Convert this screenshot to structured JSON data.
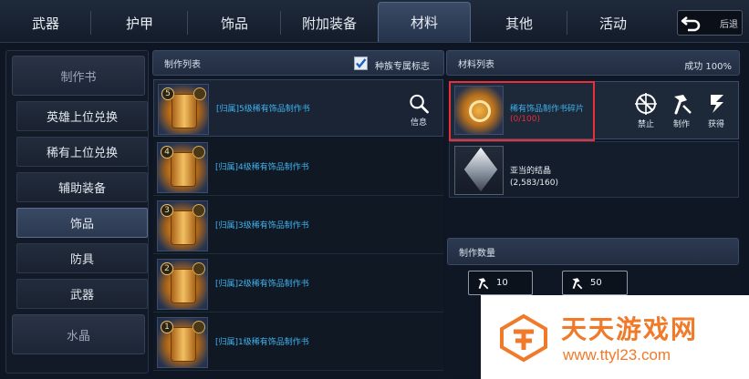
{
  "top_tabs": [
    {
      "label": "武器",
      "active": false
    },
    {
      "label": "护甲",
      "active": false
    },
    {
      "label": "饰品",
      "active": false
    },
    {
      "label": "附加装备",
      "active": false
    },
    {
      "label": "材料",
      "active": true
    },
    {
      "label": "其他",
      "active": false
    },
    {
      "label": "活动",
      "active": false
    }
  ],
  "back_button": {
    "label": "后退",
    "icon": "undo-arrow-icon"
  },
  "sidebar": {
    "header_top": "制作书",
    "items": [
      {
        "label": "英雄上位兑换",
        "active": false
      },
      {
        "label": "稀有上位兑换",
        "active": false
      },
      {
        "label": "辅助装备",
        "active": false
      },
      {
        "label": "饰品",
        "active": true
      },
      {
        "label": "防具",
        "active": false
      },
      {
        "label": "武器",
        "active": false
      }
    ],
    "header_bottom": "水晶"
  },
  "craft_list": {
    "title": "制作列表",
    "race_filter_label": "种族专属标志",
    "race_filter_checked": true,
    "info_label": "信息",
    "recipes": [
      {
        "level": "5",
        "name": "[归属]5级稀有饰品制作书",
        "selected": true
      },
      {
        "level": "4",
        "name": "[归属]4级稀有饰品制作书",
        "selected": false
      },
      {
        "level": "3",
        "name": "[归属]3级稀有饰品制作书",
        "selected": false
      },
      {
        "level": "2",
        "name": "[归属]2级稀有饰品制作书",
        "selected": false
      },
      {
        "level": "1",
        "name": "[归属]1级稀有饰品制作书",
        "selected": false
      }
    ]
  },
  "material_list": {
    "title": "材料列表",
    "success_rate": "成功 100%",
    "materials": [
      {
        "name": "稀有饰品制作书碎片",
        "count": "(0/100)",
        "name_color": "#3fb4f0",
        "count_color": "#e0303a"
      },
      {
        "name": "亚当的结晶",
        "count": "(2,583/160)",
        "name_color": "#e8edf4",
        "count_color": "#e8edf4"
      }
    ],
    "actions": [
      {
        "label": "禁止",
        "icon": "forbid-icon"
      },
      {
        "label": "制作",
        "icon": "hammer-icon"
      },
      {
        "label": "获得",
        "icon": "acquire-icon"
      }
    ]
  },
  "craft_quantity": {
    "title": "制作数量",
    "buttons": [
      {
        "label": "10",
        "icon": "hammer-icon"
      },
      {
        "label": "50",
        "icon": "hammer-icon"
      }
    ]
  },
  "watermark": {
    "title": "天天游戏网",
    "url": "www.ttyl23.com",
    "color": "#f07a2a"
  }
}
